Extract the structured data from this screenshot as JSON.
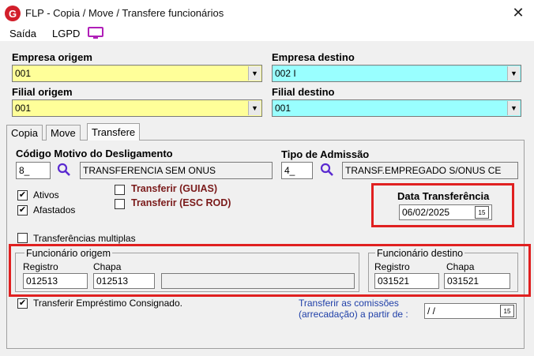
{
  "window": {
    "title": "FLP - Copia / Move / Transfere funcionários",
    "app_icon": "G"
  },
  "menu": {
    "items": [
      "Saída",
      "LGPD"
    ]
  },
  "empresa_origem": {
    "label": "Empresa origem",
    "value": "001"
  },
  "empresa_destino": {
    "label": "Empresa destino",
    "value": "002 I"
  },
  "filial_origem": {
    "label": "Filial origem",
    "value": "001"
  },
  "filial_destino": {
    "label": "Filial destino",
    "value": "001"
  },
  "tabs": [
    "Copia",
    "Move",
    "Transfere"
  ],
  "motivo": {
    "label": "Código Motivo do Desligamento",
    "code": "8_",
    "description": "TRANSFERENCIA SEM ONUS"
  },
  "admissao": {
    "label": "Tipo de Admissão",
    "code": "4_",
    "description": "TRANSF.EMPREGADO S/ONUS CE"
  },
  "checks": {
    "ativos": "Ativos",
    "afastados": "Afastados",
    "guias": "Transferir (GUIAS)",
    "esc_rod": "Transferir (ESC ROD)",
    "multiplas": "Transferências multiplas",
    "consignado": "Transferir Empréstimo Consignado."
  },
  "data_transferencia": {
    "label": "Data Transferência",
    "value": "06/02/2025"
  },
  "func_origem": {
    "title": "Funcionário origem",
    "registro_label": "Registro",
    "chapa_label": "Chapa",
    "registro": "012513",
    "chapa": "012513"
  },
  "func_destino": {
    "title": "Funcionário destino",
    "registro_label": "Registro",
    "chapa_label": "Chapa",
    "registro": "031521",
    "chapa": "031521"
  },
  "comissoes": {
    "line1": "Transferir as comissões",
    "line2": "(arrecadação)  a partir de :",
    "value": " / /"
  },
  "colors": {
    "yellow": "#ffff99",
    "cyan": "#99ffff",
    "highlight": "#e02020",
    "maroon": "#7a1a1a"
  }
}
